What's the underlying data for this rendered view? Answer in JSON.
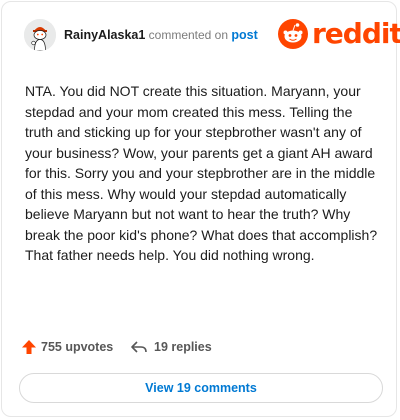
{
  "header": {
    "username": "RainyAlaska1",
    "action_text": "commented on",
    "target_link": "post"
  },
  "logo": {
    "wordmark": "reddit",
    "brand_color": "#ff4500"
  },
  "comment": {
    "body": "NTA. You did NOT create this situation. Maryann, your stepdad and your mom created this mess. Telling the truth and sticking up for your stepbrother wasn't any of your business? Wow, your parents get a giant AH award for this. Sorry you and your stepbrother are in the middle of this mess. Why would your stepdad automatically believe Maryann but not want to hear the truth? Why break the poor kid's phone? What does that accomplish? That father needs help. You did nothing wrong."
  },
  "footer": {
    "upvotes_label": "755 upvotes",
    "replies_label": "19 replies",
    "view_comments_label": "View 19 comments"
  },
  "icons": {
    "avatar": "snoo-avatar-icon",
    "upvote": "upvote-arrow-icon",
    "reply": "reply-arrow-icon",
    "logo": "reddit-snoo-icon"
  },
  "colors": {
    "link": "#0079d3",
    "upvote": "#ff4500",
    "text": "#1c1c1c"
  }
}
